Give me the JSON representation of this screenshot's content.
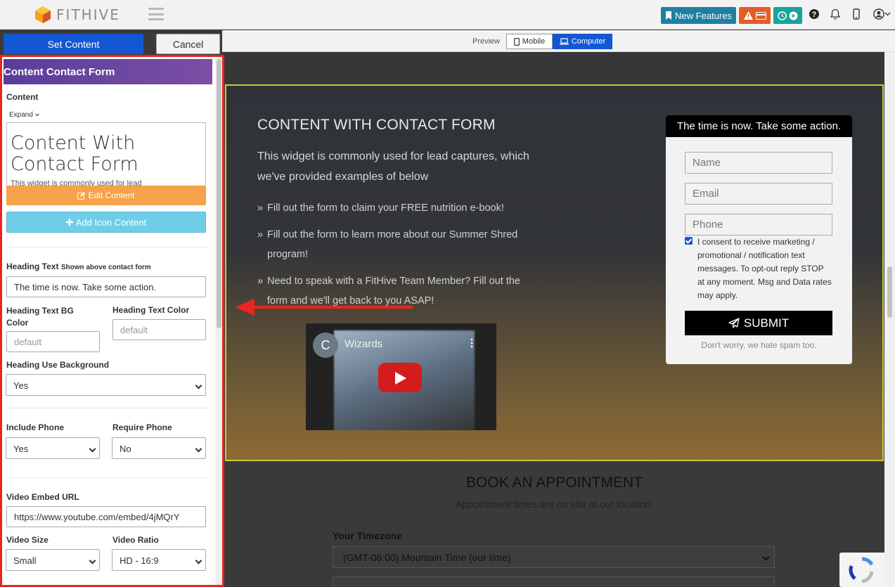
{
  "app": {
    "logo_text": "FITHIVE",
    "colors": {
      "primary": "#1357d3",
      "panel_border": "#e8261f",
      "header_purple": "#5a3d9a",
      "edit_orange": "#f5a24a",
      "icon_blue": "#6fcde8",
      "hero_border": "#c2cf3a"
    }
  },
  "topbar": {
    "new_features_label": "New Features",
    "icons": [
      "bookmark-icon",
      "warning-icon",
      "credit-card-icon",
      "clock-icon",
      "play-circle-icon",
      "help-icon",
      "bell-icon",
      "mobile-device-icon",
      "user-icon",
      "chevron-down-icon"
    ]
  },
  "toolbar": {
    "set_content_label": "Set Content",
    "cancel_label": "Cancel",
    "preview_label": "Preview",
    "mobile_label": "Mobile",
    "computer_label": "Computer",
    "active_view": "Computer"
  },
  "panel": {
    "title": "Content Contact Form",
    "content_label": "Content",
    "expand_label": "Expand",
    "content_preview_heading": "Content With Contact Form",
    "content_preview_text": "This widget is commonly used for lead",
    "edit_content_label": "Edit Content",
    "add_icon_content_label": "Add Icon Content",
    "heading_text_label": "Heading Text",
    "heading_text_hint": "Shown above contact form",
    "heading_text_value": "The time is now. Take some action.",
    "heading_bg_label": "Heading Text BG Color",
    "heading_bg_placeholder": "default",
    "heading_color_label": "Heading Text Color",
    "heading_color_placeholder": "default",
    "heading_use_bg_label": "Heading Use Background",
    "heading_use_bg_value": "Yes",
    "include_phone_label": "Include Phone",
    "include_phone_value": "Yes",
    "require_phone_label": "Require Phone",
    "require_phone_value": "No",
    "video_url_label": "Video Embed URL",
    "video_url_value": "https://www.youtube.com/embed/4jMQrY",
    "video_size_label": "Video Size",
    "video_size_value": "Small",
    "video_ratio_label": "Video Ratio",
    "video_ratio_value": "HD - 16:9"
  },
  "preview": {
    "hero_title": "CONTENT WITH CONTACT FORM",
    "hero_intro": "This widget is commonly used for lead captures, which we've provided examples of below",
    "bullets": [
      "Fill out the form to claim your FREE nutrition e-book!",
      "Fill out the form to learn more about our Summer Shred program!",
      "Need to speak with a FitHive Team Member? Fill out the form and we'll get back to you ASAP!"
    ],
    "video": {
      "avatar_letter": "C",
      "title": "Wizards"
    },
    "form": {
      "heading": "The time is now. Take some action.",
      "name_placeholder": "Name",
      "email_placeholder": "Email",
      "phone_placeholder": "Phone",
      "consent_checked": true,
      "consent_text": "I consent to receive marketing / promotional / notification text messages. To opt-out reply STOP at any moment. Msg and Data rates may apply.",
      "submit_label": "SUBMIT",
      "spam_note": "Don't worry, we hate spam too."
    },
    "booking": {
      "title": "BOOK AN APPOINTMENT",
      "subtitle": "Appointment times are on site at our location.",
      "timezone_label": "Your Timezone",
      "timezone_value": "(GMT-06:00) Mountain Time (our time)"
    }
  }
}
